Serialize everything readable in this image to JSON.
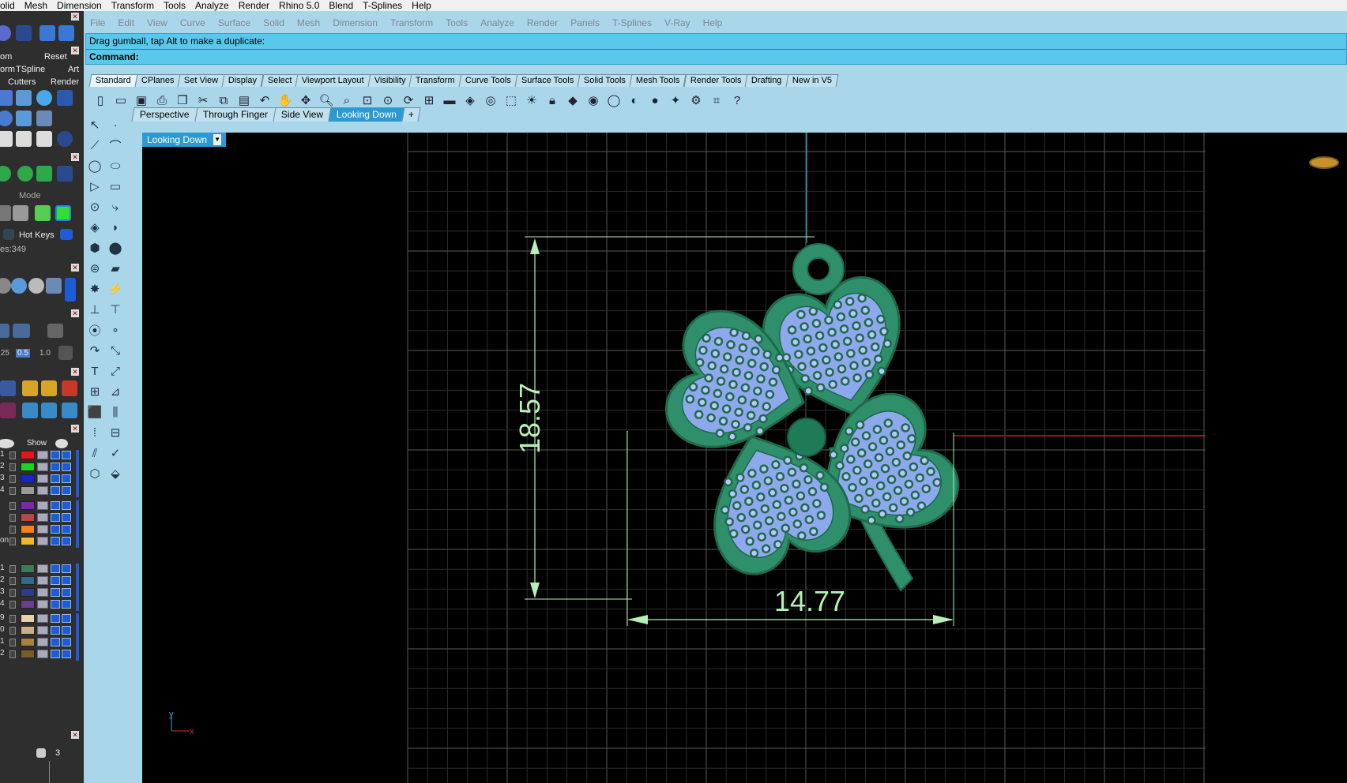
{
  "system_menu": [
    "olid",
    "Mesh",
    "Dimension",
    "Transform",
    "Tools",
    "Analyze",
    "Render",
    "Rhino 5.0",
    "Blend",
    "T-Splines",
    "Help"
  ],
  "app_menu": [
    "File",
    "Edit",
    "View",
    "Curve",
    "Surface",
    "Solid",
    "Mesh",
    "Dimension",
    "Transform",
    "Tools",
    "Analyze",
    "Render",
    "Panels",
    "T-Splines",
    "V-Ray",
    "Help"
  ],
  "command": {
    "prompt": "Drag gumball, tap Alt to make a duplicate:",
    "label": "Command:"
  },
  "toolbar_tabs": [
    "Standard",
    "CPlanes",
    "Set View",
    "Display",
    "Select",
    "Viewport Layout",
    "Visibility",
    "Transform",
    "Curve Tools",
    "Surface Tools",
    "Solid Tools",
    "Mesh Tools",
    "Render Tools",
    "Drafting",
    "New in V5"
  ],
  "toolbar_active": "Standard",
  "viewport_tabs": [
    "Perspective",
    "Through Finger",
    "Side View",
    "Looking Down"
  ],
  "viewport_active": "Looking Down",
  "viewport": {
    "name": "Looking Down",
    "dim_vertical": "18.57",
    "dim_horizontal": "14.77",
    "axis_y": "y",
    "axis_x": "x"
  },
  "left_panel": {
    "row1": [
      "om",
      "Reset"
    ],
    "row2": [
      "orm",
      "TSpline",
      "Art"
    ],
    "row3": [
      "Cutters",
      "Render"
    ],
    "mode_label": "Mode",
    "hotkeys_label": "Hot Keys",
    "count_label": "es:349",
    "scale_values": [
      ".25",
      "0.5",
      "1.0"
    ],
    "show_label": "Show",
    "page_number": "3",
    "layer_numbers": [
      "1",
      "2",
      "3",
      "4",
      "",
      "",
      "",
      "on",
      "1",
      "2",
      "3",
      "4",
      "9",
      "0",
      "1",
      "2"
    ],
    "layer_colors": [
      "#e8141a",
      "#1ed51e",
      "#1525d0",
      "#9a9a9a",
      "#7a2aa8",
      "#b84848",
      "#f08418",
      "#f0b82a",
      "#3d7a5c",
      "#2f6a88",
      "#2e3a8a",
      "#6a3e8a",
      "#e8d0b0",
      "#c9b08a",
      "#a8823e",
      "#7a5a28"
    ]
  },
  "colors": {
    "chrome": "#a9d6e9",
    "command_bar": "#5ac8ec",
    "active_tab": "#2c9ad1",
    "grid": "#3a3a3a",
    "model_green": "#2e8f6a",
    "gem_blue": "#8ea8ee",
    "dim_line": "#b8f0b8",
    "x_axis": "#c02020",
    "y_axis": "#2a8fb0"
  }
}
